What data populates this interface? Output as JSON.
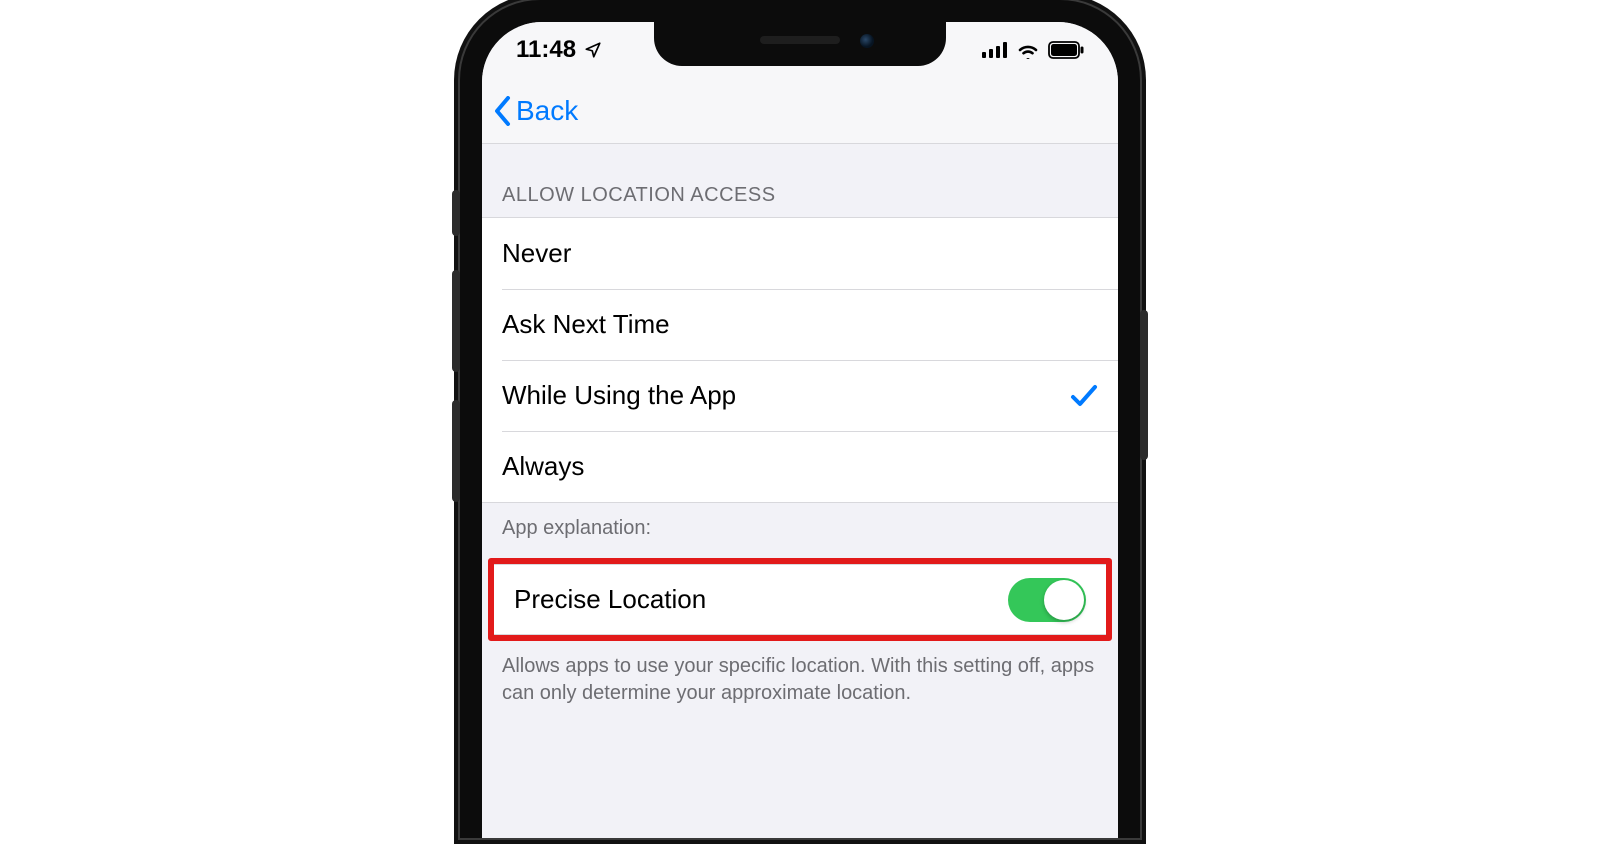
{
  "status": {
    "time": "11:48"
  },
  "nav": {
    "back_label": "Back"
  },
  "section": {
    "header": "ALLOW LOCATION ACCESS",
    "options": [
      {
        "label": "Never",
        "checked": false
      },
      {
        "label": "Ask Next Time",
        "checked": false
      },
      {
        "label": "While Using the App",
        "checked": true
      },
      {
        "label": "Always",
        "checked": false
      }
    ],
    "footer": "App explanation:"
  },
  "precise": {
    "label": "Precise Location",
    "enabled": true,
    "footer": "Allows apps to use your specific location. With this setting off, apps can only determine your approximate location."
  },
  "colors": {
    "accent": "#007aff",
    "toggle_on": "#34c759",
    "highlight": "#e21a1a"
  }
}
